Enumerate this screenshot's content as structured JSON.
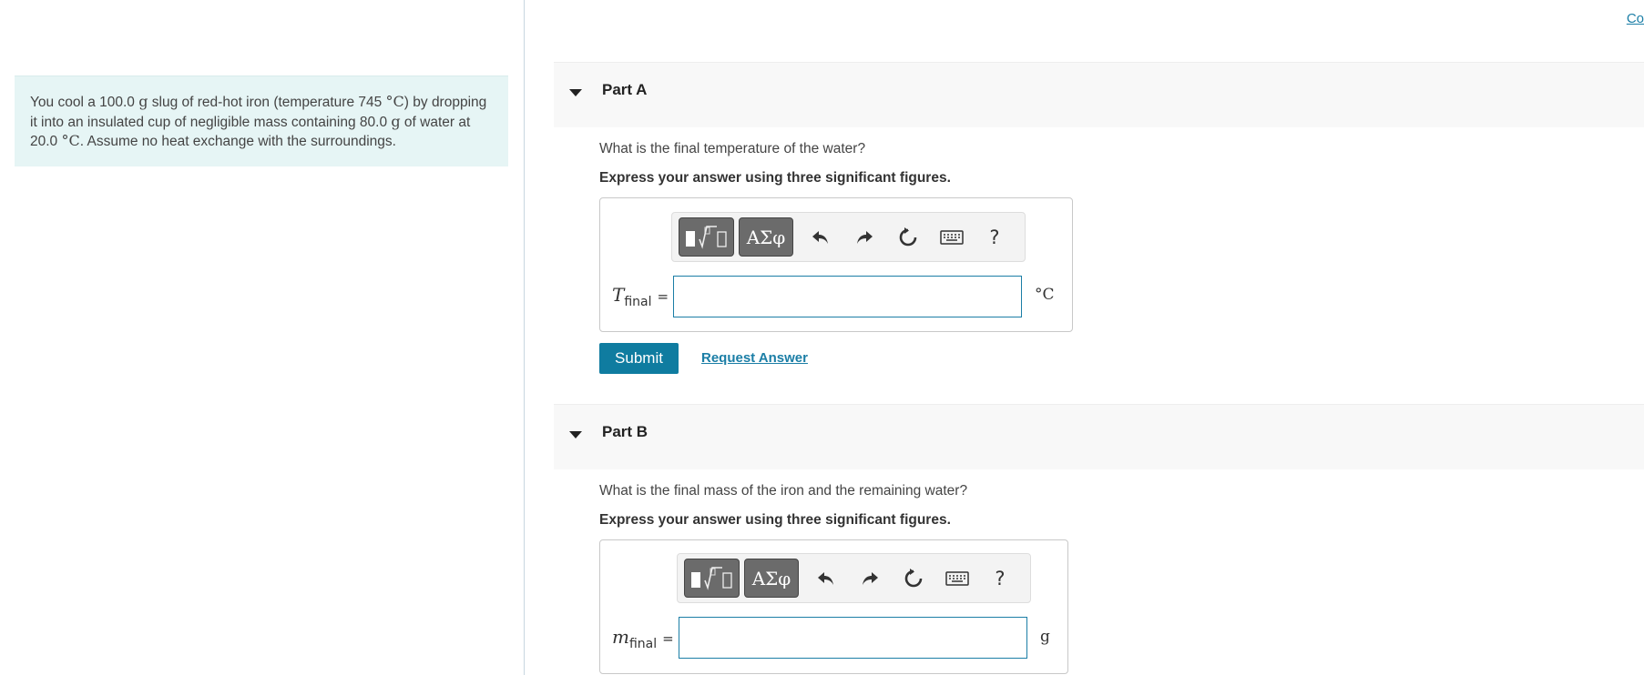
{
  "top_link": "Co",
  "problem": {
    "p1": "You cool a 100.0 ",
    "p1_unit": "g",
    "p2": " slug of red-hot iron (temperature 745 ",
    "p2_unit": "°C",
    "p3": ") by dropping it into an insulated cup of negligible mass containing 80.0 ",
    "p3_unit": "g",
    "p4": " of water at 20.0 ",
    "p4_unit": "°C",
    "p5": ". Assume no heat exchange with the surroundings."
  },
  "toolbar": {
    "greek_label": "ΑΣφ",
    "help_label": "?"
  },
  "parts": [
    {
      "title": "Part A",
      "question": "What is the final temperature of the water?",
      "instruction": "Express your answer using three significant figures.",
      "var_main": "T",
      "var_sub": "final",
      "eq": "=",
      "input_value": "",
      "unit": "°C",
      "submit_label": "Submit",
      "request_label": "Request Answer"
    },
    {
      "title": "Part B",
      "question": "What is the final mass of the iron and the remaining water?",
      "instruction": "Express your answer using three significant figures.",
      "var_main": "m",
      "var_sub": "final",
      "eq": "=",
      "input_value": "",
      "unit": "g"
    }
  ]
}
